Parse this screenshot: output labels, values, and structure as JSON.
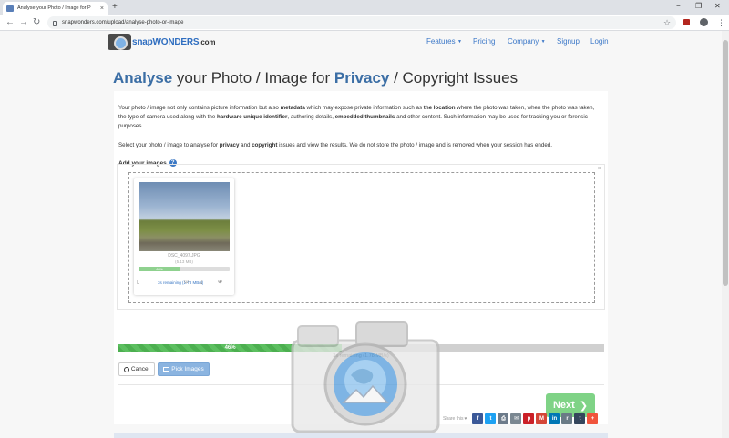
{
  "browser": {
    "tab_title": "Analyse your Photo / Image for P",
    "tab_close": "×",
    "new_tab": "+",
    "url": "snapwonders.com/upload/analyse-photo-or-image",
    "window_minimize": "−",
    "window_restore": "❐",
    "window_close": "✕"
  },
  "site": {
    "logo_snap": "snap",
    "logo_wonders": "WONDERS",
    "logo_com": ".com",
    "nav": [
      {
        "label": "Features",
        "has_caret": true
      },
      {
        "label": "Pricing",
        "has_caret": false
      },
      {
        "label": "Company",
        "has_caret": true
      },
      {
        "label": "Signup",
        "has_caret": false
      },
      {
        "label": "Login",
        "has_caret": false
      }
    ]
  },
  "title": {
    "part1": "Analyse",
    "part2": " your Photo / Image for ",
    "part3": "Privacy",
    "part4": " / Copyright Issues"
  },
  "intro": {
    "p1_a": "Your photo / image not only contains picture information but also ",
    "p1_b": "metadata",
    "p1_c": " which may expose private information such as ",
    "p1_d": "the location",
    "p1_e": " where the photo was taken, when the photo was taken, the type of camera used along with the ",
    "p1_f": "hardware unique identifier",
    "p1_g": ", authoring details, ",
    "p1_h": "embedded thumbnails",
    "p1_i": " and other content. Such information may be used for tracking you or forensic purposes.",
    "p2_a": "Select your photo / image to analyse for ",
    "p2_b": "privacy",
    "p2_c": " and ",
    "p2_d": "copyright",
    "p2_e": " issues and view the results. We do not store the photo / image and is removed when your session has ended."
  },
  "uploader": {
    "add_label": "Add your images",
    "help": "?",
    "close": "×",
    "file_name": "DSC_4097.JPG",
    "file_size": "(5.13 MB)",
    "file_progress_pct": 46,
    "file_progress_label": "46%",
    "file_remaining": "3s remaining (1.78 MB/s)",
    "progress_pct": 46,
    "progress_label": "46%",
    "status": "3s remaining (1.78 MB/s)",
    "cancel_label": "Cancel",
    "pick_label": "Pick Images",
    "next_label": "Next"
  },
  "share": {
    "label": "Share this",
    "buttons": [
      {
        "name": "facebook",
        "glyph": "f",
        "color": "#3b5998"
      },
      {
        "name": "twitter",
        "glyph": "t",
        "color": "#1da1f2"
      },
      {
        "name": "print",
        "glyph": "⎙",
        "color": "#6d7b8a"
      },
      {
        "name": "email",
        "glyph": "✉",
        "color": "#7a8791"
      },
      {
        "name": "pinterest",
        "glyph": "p",
        "color": "#cb2027"
      },
      {
        "name": "gmail",
        "glyph": "M",
        "color": "#d44638"
      },
      {
        "name": "linkedin",
        "glyph": "in",
        "color": "#0077b5"
      },
      {
        "name": "reddit",
        "glyph": "r",
        "color": "#6a7b86"
      },
      {
        "name": "tumblr",
        "glyph": "t",
        "color": "#35465c"
      },
      {
        "name": "more",
        "glyph": "+",
        "color": "#f0543c"
      }
    ]
  }
}
